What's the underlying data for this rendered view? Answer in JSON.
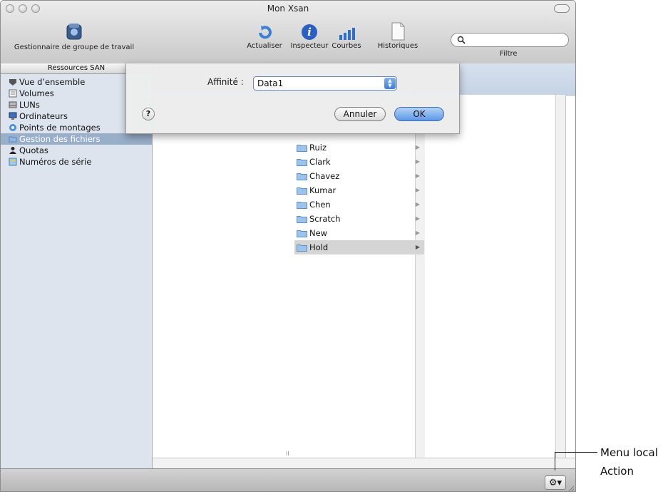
{
  "window": {
    "title": "Mon Xsan"
  },
  "toolbar": {
    "workgroup_manager": "Gestionnaire de groupe de travail",
    "refresh": "Actualiser",
    "inspector": "Inspecteur",
    "graphs": "Courbes",
    "logs": "Historiques",
    "filter_label": "Filtre",
    "search_value": ""
  },
  "sidebar": {
    "header": "Ressources SAN",
    "items": [
      {
        "label": "Vue d’ensemble",
        "icon": "overview-icon"
      },
      {
        "label": "Volumes",
        "icon": "volume-icon"
      },
      {
        "label": "LUNs",
        "icon": "lun-icon"
      },
      {
        "label": "Ordinateurs",
        "icon": "computer-icon"
      },
      {
        "label": "Points de montages",
        "icon": "mount-icon"
      },
      {
        "label": "Gestion des fichiers",
        "icon": "folder-icon",
        "selected": true
      },
      {
        "label": "Quotas",
        "icon": "person-icon"
      },
      {
        "label": "Numéros de série",
        "icon": "serial-icon"
      }
    ]
  },
  "browser": {
    "folders": [
      "Ruiz",
      "Clark",
      "Chavez",
      "Kumar",
      "Chen",
      "Scratch",
      "New",
      "Hold"
    ],
    "selected_folder": "Hold"
  },
  "sheet": {
    "affinity_label": "Affinité :",
    "affinity_value": "Data1",
    "help": "?",
    "cancel_label": "Annuler",
    "ok_label": "OK"
  },
  "callout": {
    "line1": "Menu local",
    "line2": "Action"
  },
  "colors": {
    "selection": "#99aec9",
    "sidebar_bg": "#dde4ee",
    "ok_button": "#5d98e6"
  }
}
